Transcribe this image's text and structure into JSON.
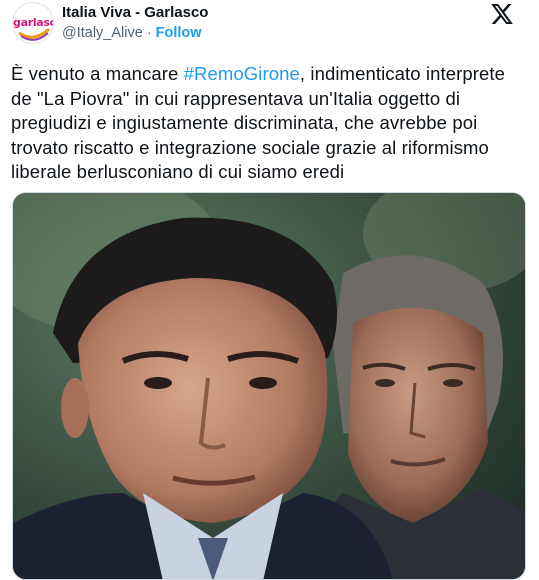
{
  "account": {
    "display_name": "Italia Viva - Garlasco",
    "handle": "@Italy_Alive",
    "separator": "·",
    "follow_label": "Follow",
    "avatar_text": "garlasco",
    "avatar_colors": [
      "#d4187a",
      "#f39c12",
      "#8e44ad"
    ]
  },
  "tweet": {
    "text_before": "È venuto a mancare ",
    "hashtag": "#RemoGirone",
    "text_after": ", indimenticato interprete de \"La Piovra\" in cui rappresentava un'Italia oggetto di pregiudizi e  ingiustamente discriminata, che avrebbe poi trovato riscatto e integrazione sociale grazie al riformismo liberale berlusconiano di cui siamo eredi"
  },
  "media": {
    "subject": "photo of two men in suits, one in foreground, one behind",
    "icon": "photo"
  },
  "icons": {
    "platform_logo": "x-logo-icon"
  },
  "colors": {
    "link": "#1d9bf0",
    "text": "#0f1419",
    "secondary": "#536471"
  }
}
